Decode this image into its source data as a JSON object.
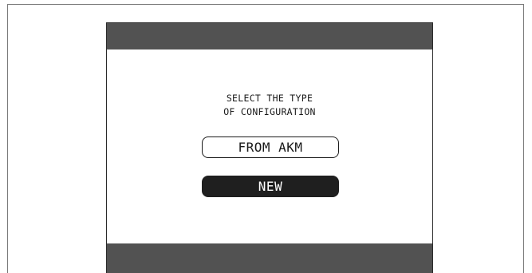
{
  "screen": {
    "prompt_line1": "SELECT THE TYPE",
    "prompt_line2": "OF CONFIGURATION",
    "options": [
      {
        "label": "FROM AKM",
        "selected": false
      },
      {
        "label": "NEW",
        "selected": true
      }
    ]
  },
  "colors": {
    "bar": "#525252",
    "selected_bg": "#1f1f1f",
    "text": "#1a1a1a"
  }
}
